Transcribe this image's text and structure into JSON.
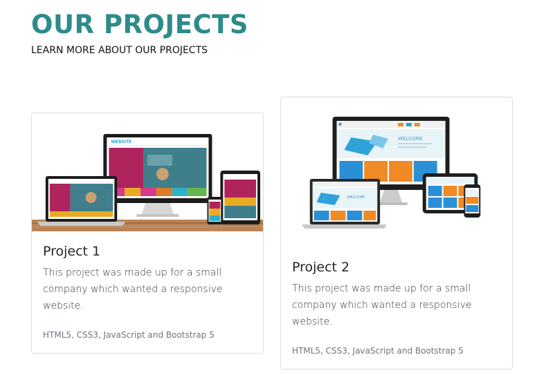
{
  "header": {
    "title": "OUR PROJECTS",
    "subtitle": "LEARN MORE ABOUT OUR PROJECTS"
  },
  "projects": [
    {
      "title": "Project 1",
      "description": "This project was made up for a small company which wanted a responsive website.",
      "tech": "HTML5, CSS3, JavaScript and Bootstrap 5",
      "image_icon": "responsive-devices-image"
    },
    {
      "title": "Project 2",
      "description": "This project was made up for a small company which wanted a responsive website.",
      "tech": "HTML5, CSS3, JavaScript and Bootstrap 5",
      "image_icon": "responsive-devices-image"
    }
  ],
  "mockup_text": {
    "site_label": "WEBSITE",
    "welcome_label": "WELCOME"
  },
  "colors": {
    "heading": "#2e8b8b",
    "card_border": "#dcdcdc"
  }
}
